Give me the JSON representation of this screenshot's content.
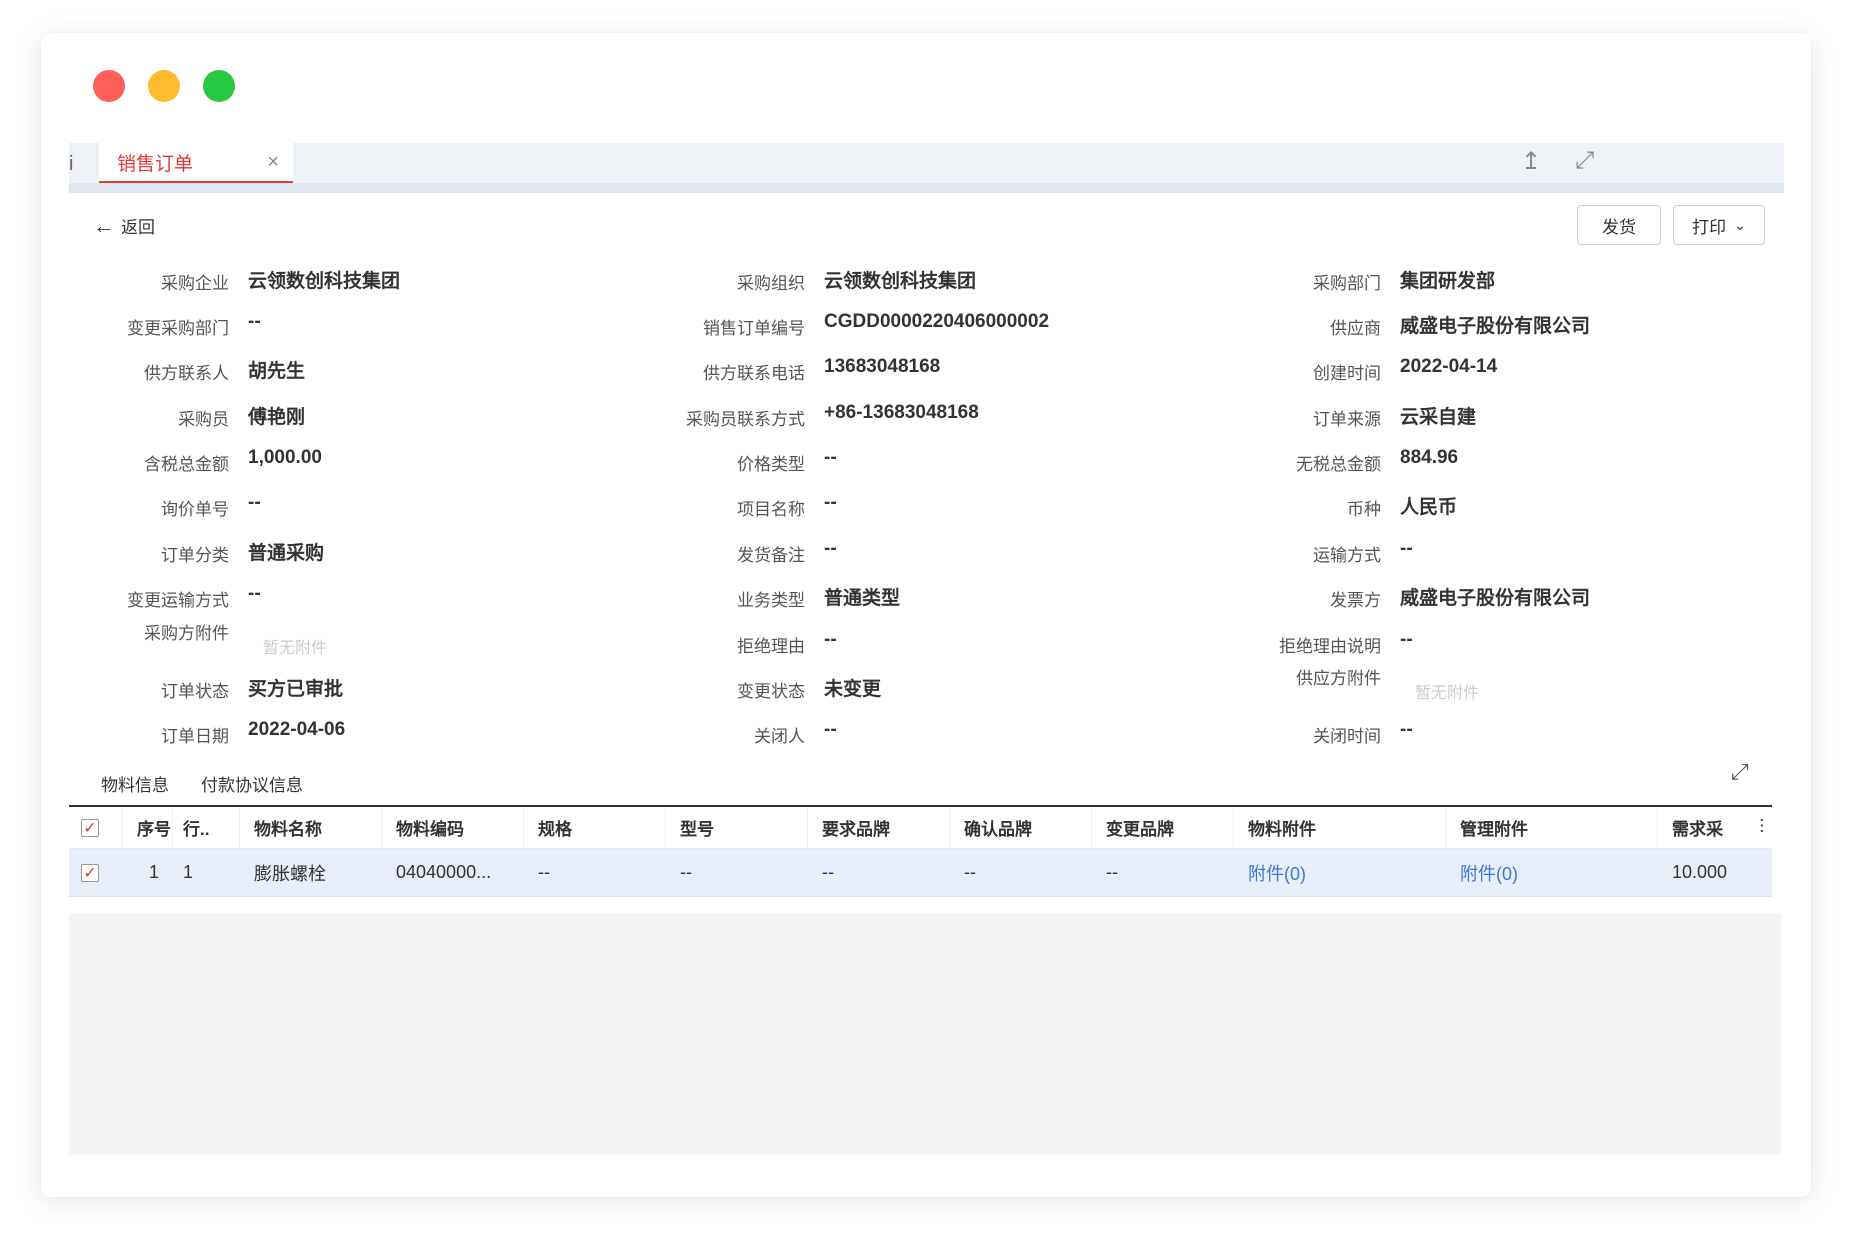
{
  "tab": {
    "left_glyph": "i",
    "label": "销售订单",
    "close": "×",
    "upload_icon": "↥",
    "expand_icon": "⤢"
  },
  "toolbar": {
    "back_label": "返回",
    "ship_label": "发货",
    "print_label": "打印"
  },
  "fields": [
    {
      "label": "采购企业",
      "value": "云领数创科技集团"
    },
    {
      "label": "采购组织",
      "value": "云领数创科技集团"
    },
    {
      "label": "采购部门",
      "value": "集团研发部"
    },
    {
      "label": "变更采购部门",
      "value": "--"
    },
    {
      "label": "销售订单编号",
      "value": "CGDD0000220406000002"
    },
    {
      "label": "供应商",
      "value": "威盛电子股份有限公司"
    },
    {
      "label": "供方联系人",
      "value": "胡先生"
    },
    {
      "label": "供方联系电话",
      "value": "13683048168"
    },
    {
      "label": "创建时间",
      "value": "2022-04-14"
    },
    {
      "label": "采购员",
      "value": "傅艳刚"
    },
    {
      "label": "采购员联系方式",
      "value": "+86-13683048168"
    },
    {
      "label": "订单来源",
      "value": "云采自建"
    },
    {
      "label": "含税总金额",
      "value": "1,000.00"
    },
    {
      "label": "价格类型",
      "value": "--"
    },
    {
      "label": "无税总金额",
      "value": "884.96"
    },
    {
      "label": "询价单号",
      "value": "--"
    },
    {
      "label": "项目名称",
      "value": "--"
    },
    {
      "label": "币种",
      "value": "人民币"
    },
    {
      "label": "订单分类",
      "value": "普通采购"
    },
    {
      "label": "发货备注",
      "value": "--"
    },
    {
      "label": "运输方式",
      "value": "--"
    },
    {
      "label": "变更运输方式",
      "value": "--"
    },
    {
      "label": "业务类型",
      "value": "普通类型"
    },
    {
      "label": "发票方",
      "value": "威盛电子股份有限公司"
    },
    {
      "label": "采购方附件",
      "value": "暂无附件"
    },
    {
      "label": "拒绝理由",
      "value": "--"
    },
    {
      "label": "拒绝理由说明",
      "value": "--"
    },
    {
      "label": "订单状态",
      "value": "买方已审批"
    },
    {
      "label": "变更状态",
      "value": "未变更"
    },
    {
      "label": "供应方附件",
      "value": "暂无附件"
    },
    {
      "label": "订单日期",
      "value": "2022-04-06"
    },
    {
      "label": "关闭人",
      "value": "--"
    },
    {
      "label": "关闭时间",
      "value": "--"
    }
  ],
  "subtabs": [
    "物料信息",
    "付款协议信息"
  ],
  "table": {
    "columns": [
      "序号",
      "行..",
      "物料名称",
      "物料编码",
      "规格",
      "型号",
      "要求品牌",
      "确认品牌",
      "变更品牌",
      "物料附件",
      "管理附件",
      "需求采"
    ],
    "rows": [
      [
        "1",
        "1",
        "膨胀螺栓",
        "04040000...",
        "--",
        "--",
        "--",
        "--",
        "--",
        "附件(0)",
        "附件(0)",
        "10.000"
      ]
    ],
    "check_mark": "✓",
    "filter_icon": "⫶"
  }
}
